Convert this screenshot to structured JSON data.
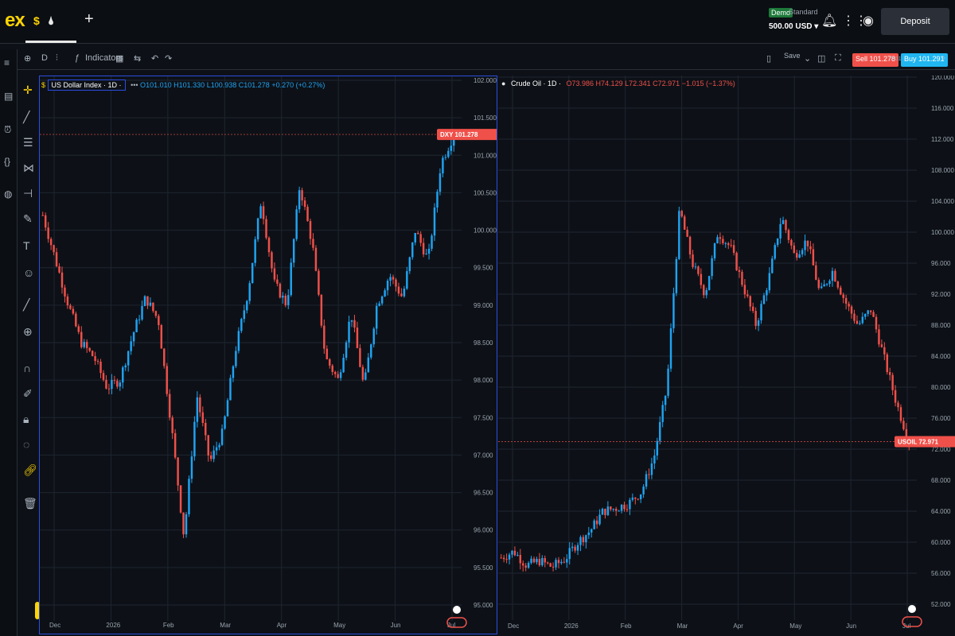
{
  "header": {
    "logo": "ex",
    "tabs": [
      {
        "icon": "$",
        "label": "$"
      },
      {
        "icon": "drop",
        "label": "🌢"
      }
    ],
    "add_tab": "+",
    "account": {
      "badge": "Demo",
      "type": "Standard",
      "balance": "500.00 USD ▾"
    },
    "deposit_label": "Deposit"
  },
  "toolbar": {
    "timeframe": "D",
    "indicators_label": "Indicators",
    "save_label": "Save",
    "sell_label": "Sell 101.278",
    "spread": "0.01",
    "buy_label": "Buy 101.291"
  },
  "colors": {
    "up": "#1fa3f2",
    "down": "#f0504a",
    "grid": "#1e2530",
    "accent": "#2b4de0"
  },
  "charts": [
    {
      "symbol_label": "US Dollar Index · 1D ·",
      "ohlc": {
        "o": "101.010",
        "h": "101.330",
        "l": "100.938",
        "c": "101.278",
        "chg": "+0.270 (+0.27%)"
      },
      "ticker": "DXY",
      "last": "101.278",
      "y_ticks": [
        "102.000",
        "101.500",
        "101.000",
        "100.500",
        "100.000",
        "99.500",
        "99.000",
        "98.500",
        "98.000",
        "97.500",
        "97.000",
        "96.500",
        "96.000",
        "95.500",
        "95.000"
      ],
      "x_ticks": [
        "Dec",
        "2026",
        "Feb",
        "Mar",
        "Apr",
        "May",
        "Jun",
        "Jul"
      ]
    },
    {
      "symbol_label": "Crude Oil · 1D ·",
      "ohlc": {
        "o": "73.986",
        "h": "74.129",
        "l": "72.341",
        "c": "72.971",
        "chg": "−1.015 (−1.37%)"
      },
      "ticker": "USOIL",
      "last": "72.971",
      "y_ticks": [
        "120.000",
        "116.000",
        "112.000",
        "108.000",
        "104.000",
        "100.000",
        "96.000",
        "92.000",
        "88.000",
        "84.000",
        "80.000",
        "76.000",
        "72.000",
        "68.000",
        "64.000",
        "60.000",
        "56.000",
        "52.000"
      ],
      "x_ticks": [
        "Dec",
        "2026",
        "Feb",
        "Mar",
        "Apr",
        "May",
        "Jun",
        "Jul"
      ]
    }
  ],
  "chart_data": [
    {
      "type": "candlestick",
      "title": "US Dollar Index · 1D",
      "ylim": [
        95.0,
        102.0
      ],
      "x": [
        "Dec",
        "2026",
        "Feb",
        "Mar",
        "Apr",
        "May",
        "Jun"
      ],
      "close_path": [
        100.2,
        99.6,
        99.0,
        98.5,
        98.3,
        97.9,
        98.0,
        98.6,
        99.1,
        98.8,
        97.4,
        95.9,
        97.8,
        96.9,
        97.3,
        98.4,
        99.2,
        100.4,
        99.3,
        99.0,
        100.6,
        99.8,
        98.3,
        98.0,
        98.9,
        97.9,
        99.0,
        99.4,
        99.1,
        100.0,
        99.6,
        100.9,
        101.278
      ]
    },
    {
      "type": "candlestick",
      "title": "Crude Oil · 1D",
      "ylim": [
        52.0,
        120.0
      ],
      "x": [
        "Dec",
        "2026",
        "Feb",
        "Mar",
        "Apr",
        "May",
        "Jun"
      ],
      "close_path": [
        58.0,
        58.8,
        57.0,
        57.6,
        56.8,
        57.8,
        60.0,
        61.5,
        64.0,
        64.4,
        65.0,
        66.5,
        71.0,
        80.0,
        103.0,
        96.0,
        92.0,
        100.0,
        98.0,
        93.0,
        88.0,
        94.0,
        102.0,
        97.0,
        99.0,
        92.0,
        95.0,
        91.0,
        88.0,
        90.0,
        84.0,
        78.0,
        72.971
      ]
    }
  ]
}
